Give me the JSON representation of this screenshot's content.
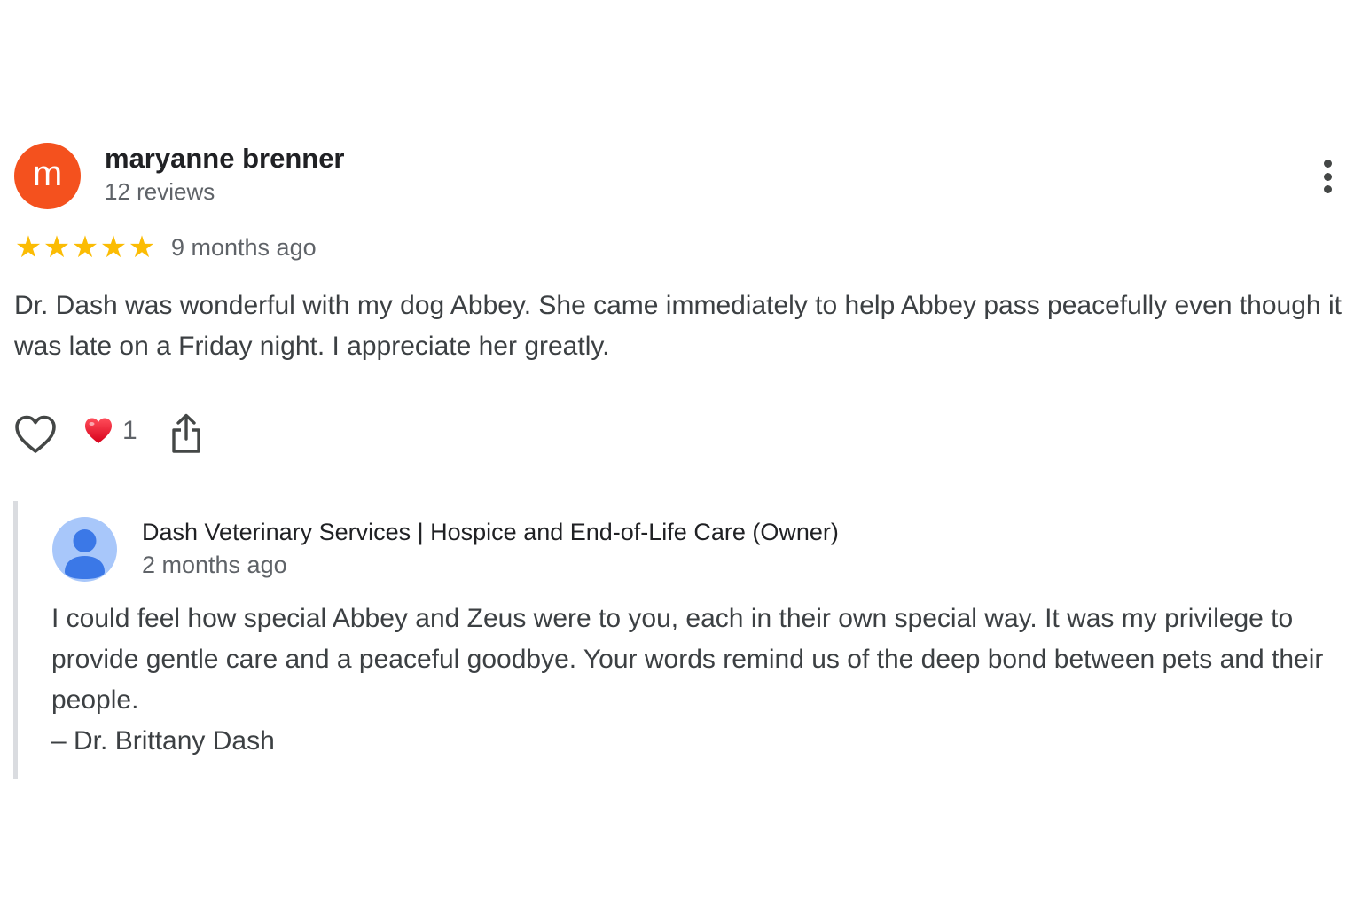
{
  "review": {
    "avatar_letter": "m",
    "avatar_color": "#f4511e",
    "reviewer_name": "maryanne brenner",
    "reviewer_meta": "12 reviews",
    "rating": 5,
    "rating_max": 5,
    "star_color": "#fbbc04",
    "time": "9 months ago",
    "text": "Dr. Dash was wonderful with my dog Abbey. She came immediately to help Abbey pass peacefully even though it was late on a Friday night. I appreciate her greatly.",
    "more_icon": "more-vert-icon"
  },
  "actions": {
    "like_icon": "heart-outline-icon",
    "reaction_icon": "red-heart-icon",
    "reaction_count": "1",
    "share_icon": "share-icon"
  },
  "owner_reply": {
    "name": "Dash Veterinary Services | Hospice and End-of-Life Care (Owner)",
    "time": "2 months ago",
    "avatar_icon": "person-icon",
    "avatar_color": "#a8c7fa",
    "text": "I could feel how special Abbey and Zeus were to you, each in their own special way. It was my privilege to provide gentle care and a peaceful goodbye. Your words remind us of the deep bond between pets and their people.",
    "signature": "– Dr. Brittany Dash"
  }
}
